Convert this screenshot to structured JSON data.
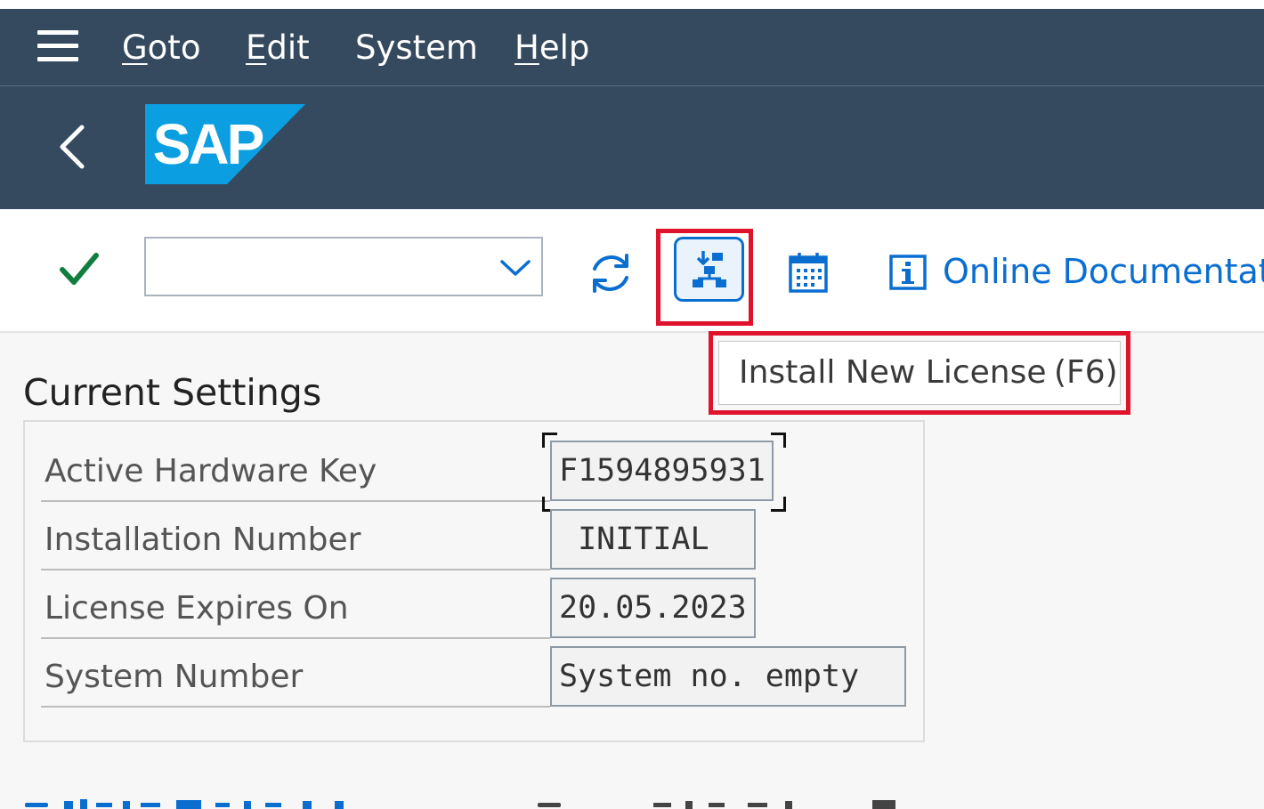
{
  "menubar": {
    "items": [
      {
        "label": "Goto",
        "underline": "G",
        "rest": "oto"
      },
      {
        "label": "Edit",
        "underline": "E",
        "rest": "dit"
      },
      {
        "label": "System",
        "underline": "",
        "rest": "System"
      },
      {
        "label": "Help",
        "underline": "H",
        "rest": "elp"
      }
    ]
  },
  "shell": {
    "logo_text": "SAP",
    "logo_color": "#0b9fe2"
  },
  "toolbar": {
    "command_field_value": "",
    "online_documentation": "Online Documentatio"
  },
  "tooltip": {
    "label": "Install New License",
    "shortcut": "(F6)"
  },
  "section": {
    "title": "Current Settings",
    "fields": [
      {
        "label": "Active Hardware Key",
        "value": "F1594895931"
      },
      {
        "label": "Installation Number",
        "value": " INITIAL"
      },
      {
        "label": "License Expires On",
        "value": "20.05.2023"
      },
      {
        "label": "System Number",
        "value": "System no. empty"
      }
    ]
  },
  "colors": {
    "shell_bg": "#354a5f",
    "accent": "#0a6ed1",
    "highlight": "#e0132c",
    "success": "#107e3e"
  }
}
